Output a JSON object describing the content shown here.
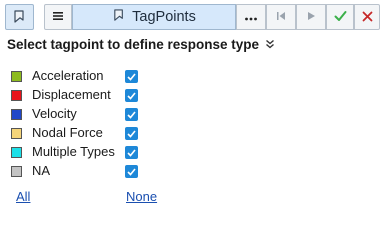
{
  "toolbar": {
    "title": "TagPoints",
    "icons": [
      "tag-icon",
      "list-icon",
      "more-icon",
      "skip-back-icon",
      "play-icon",
      "check-icon",
      "close-icon"
    ]
  },
  "heading": "Select tagpoint to define response type",
  "types": [
    {
      "label": "Acceleration",
      "color": "#8dbb1f",
      "checked": true
    },
    {
      "label": "Displacement",
      "color": "#e8141b",
      "checked": true
    },
    {
      "label": "Velocity",
      "color": "#2147c8",
      "checked": true
    },
    {
      "label": "Nodal Force",
      "color": "#f5d57a",
      "checked": true
    },
    {
      "label": "Multiple Types",
      "color": "#1de0e8",
      "checked": true
    },
    {
      "label": "NA",
      "color": "#c4c4c4",
      "checked": true
    }
  ],
  "links": {
    "all": "All",
    "none": "None"
  },
  "colors": {
    "accent": "#1e88d8",
    "link": "#1a4fb0",
    "ok": "#3bb04a",
    "close": "#c62828"
  }
}
